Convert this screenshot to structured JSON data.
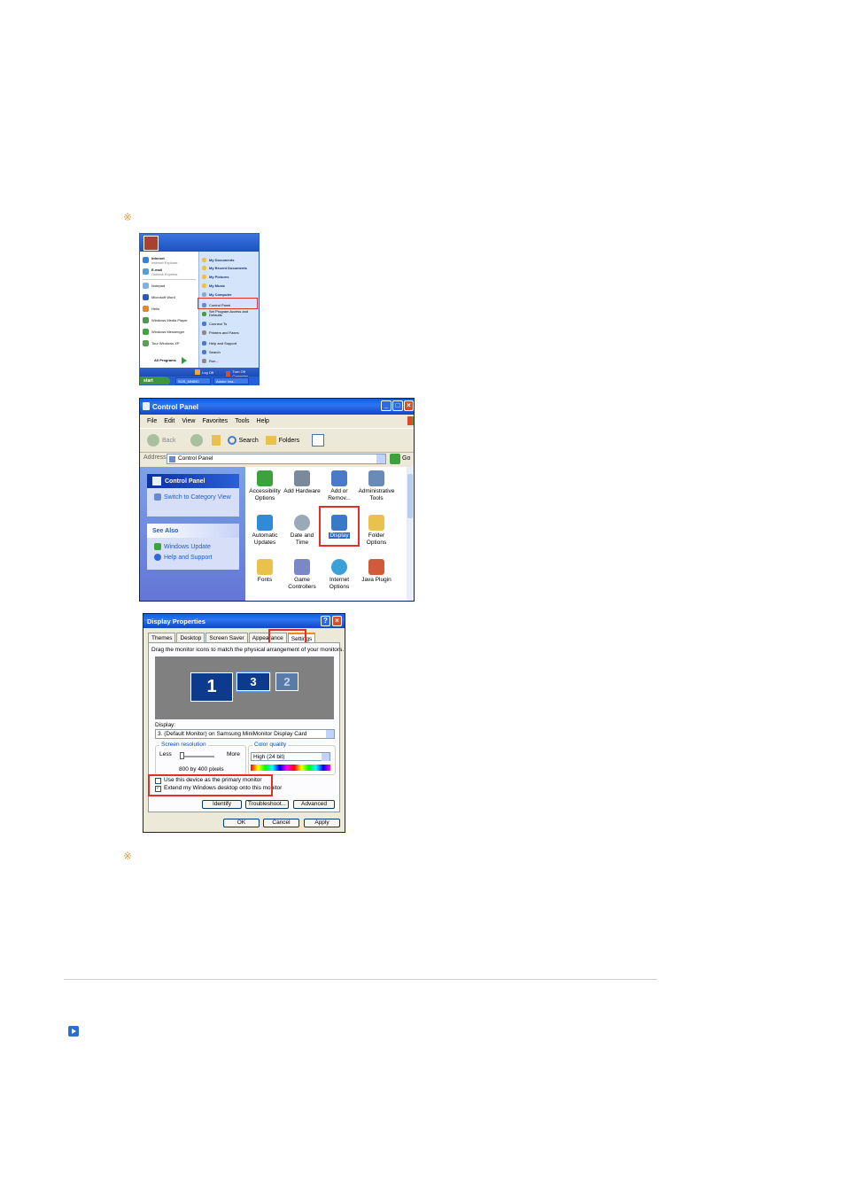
{
  "notes": {
    "bullet_1": "※",
    "bullet_2": "※"
  },
  "start_menu": {
    "pinned": [
      {
        "label": "Internet",
        "sub": "Internet Explorer",
        "color": "#3a7ed8"
      },
      {
        "label": "E-mail",
        "sub": "Outlook Express",
        "color": "#4aa0e0"
      }
    ],
    "recent": [
      {
        "label": "Notepad",
        "color": "#7fb3e8"
      },
      {
        "label": "Microsoft Word",
        "color": "#2a5cb8"
      },
      {
        "label": "Hello",
        "color": "#e08a2a"
      },
      {
        "label": "Windows Media Player",
        "color": "#4a9a4a"
      },
      {
        "label": "Windows Messenger",
        "color": "#38a838"
      },
      {
        "label": "Tour Windows XP",
        "color": "#5aa05a"
      }
    ],
    "all_programs": "All Programs",
    "right_items": [
      {
        "label": "My Documents",
        "color": "#e8c24a"
      },
      {
        "label": "My Recent Documents",
        "color": "#e8c24a"
      },
      {
        "label": "My Pictures",
        "color": "#e8c24a"
      },
      {
        "label": "My Music",
        "color": "#e8c24a"
      },
      {
        "label": "My Computer",
        "color": "#8fa8c8"
      },
      {
        "label": "Control Panel",
        "color": "#6a8ad0"
      },
      {
        "label": "Set Program Access and Defaults",
        "color": "#4a9a4a"
      },
      {
        "label": "Connect To",
        "color": "#4a7ac8"
      },
      {
        "label": "Printers and Faxes",
        "color": "#8a8a8a"
      },
      {
        "label": "Help and Support",
        "color": "#4a7ac8"
      },
      {
        "label": "Search",
        "color": "#4a7ac8"
      },
      {
        "label": "Run...",
        "color": "#8a8a8a"
      }
    ],
    "log_off": "Log Off",
    "turn_off": "Turn Off Computer",
    "start": "start",
    "taskbar": [
      "SOS_MN890",
      "Adobe Ima..."
    ]
  },
  "control_panel": {
    "title": "Control Panel",
    "menu": [
      "File",
      "Edit",
      "View",
      "Favorites",
      "Tools",
      "Help"
    ],
    "toolbar": {
      "back": "Back",
      "search": "Search",
      "folders": "Folders"
    },
    "address_label": "Address",
    "address_value": "Control Panel",
    "go": "Go",
    "side_title": "Control Panel",
    "switch_link": "Switch to Category View",
    "see_also": "See Also",
    "see_also_links": [
      "Windows Update",
      "Help and Support"
    ],
    "icons": [
      {
        "l1": "Accessibility",
        "l2": "Options",
        "color": "#3ca23c"
      },
      {
        "l1": "Add Hardware",
        "l2": "",
        "color": "#7a8a9a"
      },
      {
        "l1": "Add or",
        "l2": "Remov...",
        "color": "#4a7ac8"
      },
      {
        "l1": "Administrative",
        "l2": "Tools",
        "color": "#6a8ab8"
      },
      {
        "l1": "Automatic",
        "l2": "Updates",
        "color": "#2f8ad8"
      },
      {
        "l1": "Date and Time",
        "l2": "",
        "color": "#9aa8b8"
      },
      {
        "l1": "Display",
        "l2": "",
        "color": "#3a78c8"
      },
      {
        "l1": "Folder Options",
        "l2": "",
        "color": "#e8c24a"
      },
      {
        "l1": "Fonts",
        "l2": "",
        "color": "#e8c24a"
      },
      {
        "l1": "Game",
        "l2": "Controllers",
        "color": "#7a88c8"
      },
      {
        "l1": "Internet",
        "l2": "Options",
        "color": "#3aa0d8"
      },
      {
        "l1": "Java Plugin",
        "l2": "",
        "color": "#d05a3a"
      }
    ]
  },
  "display_properties": {
    "title": "Display Properties",
    "tabs": [
      "Themes",
      "Desktop",
      "Screen Saver",
      "Appearance",
      "Settings"
    ],
    "instruction": "Drag the monitor icons to match the physical arrangement of your monitors.",
    "monitors": [
      "1",
      "3",
      "2"
    ],
    "display_label": "Display:",
    "display_value": "3. (Default Monitor) on Samsung MiniMonitor Display Card",
    "resolution_title": "Screen resolution",
    "less": "Less",
    "more": "More",
    "resolution_value": "800 by 400 pixels",
    "color_title": "Color quality",
    "color_value": "High (24 bit)",
    "chk_primary": "Use this device as the primary monitor",
    "chk_extend": "Extend my Windows desktop onto this monitor",
    "btn_identify": "Identify",
    "btn_troubleshoot": "Troubleshoot...",
    "btn_advanced": "Advanced",
    "btn_ok": "OK",
    "btn_cancel": "Cancel",
    "btn_apply": "Apply"
  }
}
